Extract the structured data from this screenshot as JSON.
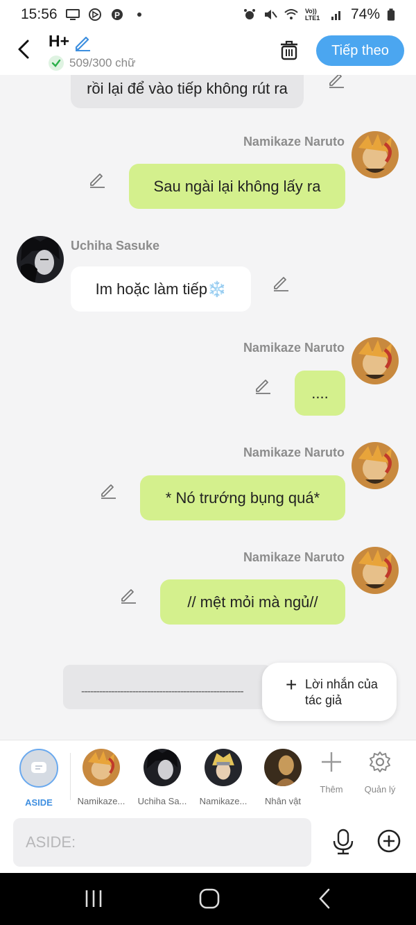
{
  "status_bar": {
    "time": "15:56",
    "battery": "74%",
    "network": "Vo)) LTE1"
  },
  "header": {
    "title": "H+",
    "word_count": "509/300 chữ",
    "next_label": "Tiếp theo"
  },
  "messages": [
    {
      "author": "",
      "text": "rồi lại để vào tiếp không rút ra",
      "side": "left-partial"
    },
    {
      "author": "Namikaze Naruto",
      "text": "Sau ngài lại không lấy ra",
      "side": "right"
    },
    {
      "author": "Uchiha Sasuke",
      "text": "Im hoặc làm tiếp❄️",
      "side": "left"
    },
    {
      "author": "Namikaze Naruto",
      "text": "....",
      "side": "right"
    },
    {
      "author": "Namikaze Naruto",
      "text": "* Nó trướng bụng quá*",
      "side": "right"
    },
    {
      "author": "Namikaze Naruto",
      "text": "// mệt mỏi mà ngủ//",
      "side": "right"
    }
  ],
  "note_dashes": "------------------------------------------------------",
  "author_note": {
    "label": "Lời nhắn của tác giả"
  },
  "characters": [
    {
      "label": "ASIDE"
    },
    {
      "label": "Namikaze..."
    },
    {
      "label": "Uchiha Sa..."
    },
    {
      "label": "Namikaze..."
    },
    {
      "label": "Nhân vật"
    }
  ],
  "tools": {
    "add_label": "Thêm",
    "manage_label": "Quản lý"
  },
  "input": {
    "placeholder": "ASIDE:"
  },
  "colors": {
    "accent": "#4ba6f0",
    "my_bubble": "#d4f08d",
    "other_bubble": "#ffffff",
    "background": "#f4f4f5"
  }
}
